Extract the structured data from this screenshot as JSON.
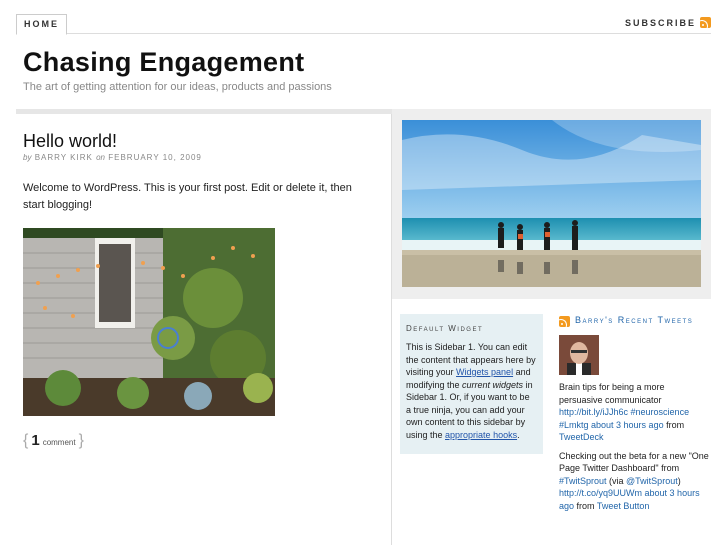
{
  "nav": {
    "home": "HOME",
    "subscribe": "SUBSCRIBE"
  },
  "site": {
    "title": "Chasing Engagement",
    "description": "The art of getting attention for our ideas, products and passions"
  },
  "post": {
    "title": "Hello world!",
    "meta_by": "by",
    "meta_author": "BARRY KIRK",
    "meta_on": "on",
    "meta_date": "FEBRUARY 10, 2009",
    "body": "Welcome to WordPress. This is your first post. Edit or delete it, then start blogging!",
    "comment_open": "{",
    "comment_count": "1",
    "comment_label": "comment",
    "comment_close": "}"
  },
  "widget": {
    "title": "Default Widget",
    "text_1": "This is Sidebar 1. You can edit the content that appears here by visiting your ",
    "link_1": "Widgets panel",
    "text_2": " and modifying the ",
    "em_1": "current widgets",
    "text_3": " in Sidebar 1. Or, if you want to be a true ninja, you can add your own content to this sidebar by using the ",
    "link_2": "appropriate hooks",
    "text_4": "."
  },
  "tweets": {
    "title": "Barry's Recent Tweets",
    "items": [
      {
        "text": "Brain tips for being a more persuasive communicator ",
        "link1": "http://bit.ly/iJJh6c",
        "tags": " #neuroscience #Lmktg",
        "time": " about 3 hours ago",
        "from": " from ",
        "source": "TweetDeck"
      },
      {
        "text": "Checking out the beta for a new \"One Page Twitter Dashboard\" from ",
        "link1": "#TwitSprout",
        "mid": " (via ",
        "link2": "@TwitSprout",
        "mid2": ") ",
        "link3": "http://t.co/yq9UUWm",
        "time": " about 3 hours ago",
        "from": " from ",
        "source": "Tweet Button"
      }
    ]
  },
  "colors": {
    "accent": "#2266aa",
    "rss": "#f39a1f",
    "widget_bg": "#e6f0f3"
  }
}
